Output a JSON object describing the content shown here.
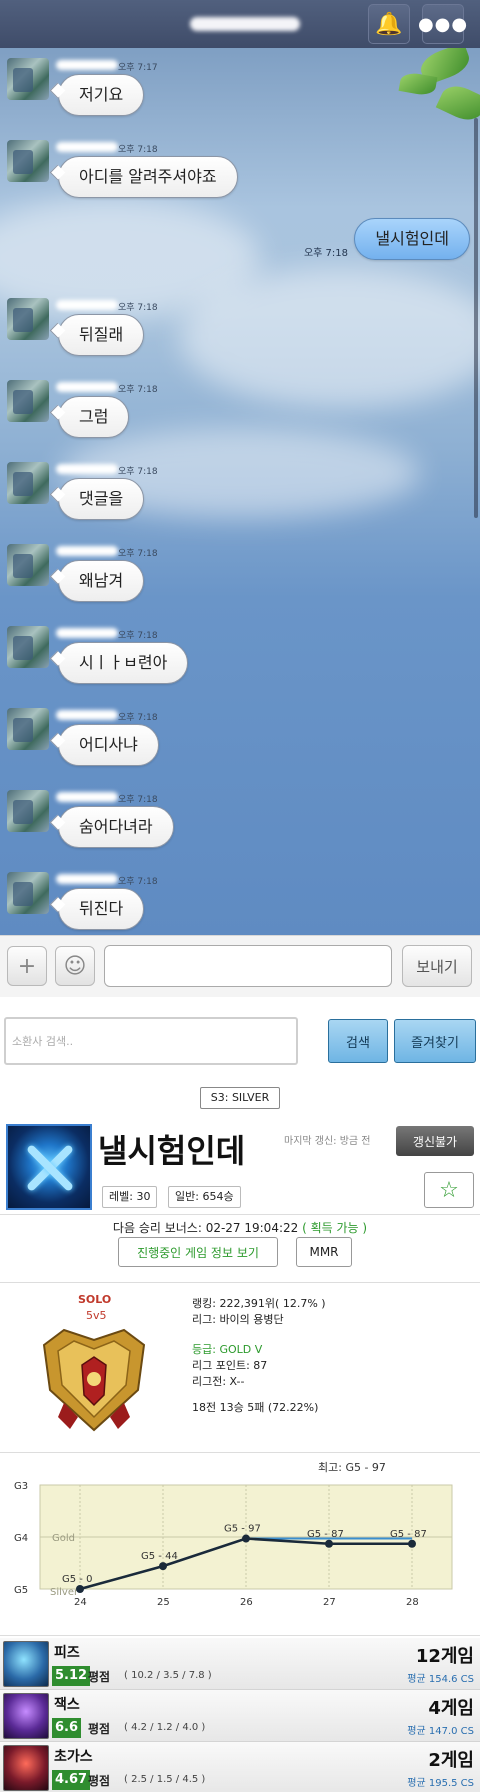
{
  "header": {
    "bell_icon": "bell-icon",
    "more_icon": "more-icon"
  },
  "chat": {
    "messages": [
      {
        "dir": "in",
        "time": "오후 7:17",
        "text": "저기요"
      },
      {
        "dir": "in",
        "time": "오후 7:18",
        "text": "아디를 알려주셔야죠"
      },
      {
        "dir": "out",
        "time": "오후 7:18",
        "text": "낼시험인데"
      },
      {
        "dir": "in",
        "time": "오후 7:18",
        "text": "뒤질래"
      },
      {
        "dir": "in",
        "time": "오후 7:18",
        "text": "그럼"
      },
      {
        "dir": "in",
        "time": "오후 7:18",
        "text": "댓글을"
      },
      {
        "dir": "in",
        "time": "오후 7:18",
        "text": "왜남겨"
      },
      {
        "dir": "in",
        "time": "오후 7:18",
        "text": "시ㅣㅏㅂ련아"
      },
      {
        "dir": "in",
        "time": "오후 7:18",
        "text": "어디사냐"
      },
      {
        "dir": "in",
        "time": "오후 7:18",
        "text": "숨어다녀라"
      },
      {
        "dir": "in",
        "time": "오후 7:18",
        "text": "뒤진다"
      }
    ]
  },
  "input_bar": {
    "plus_icon": "+",
    "emoji_icon": "☺",
    "send_label": "보내기"
  },
  "search": {
    "placeholder": "소환사 검색..",
    "search_label": "검색",
    "favorites_label": "즐겨찾기",
    "season_badge": "S3: SILVER"
  },
  "profile": {
    "summoner_name": "낼시험인데",
    "last_update": "마지막 갱신: 방금 전",
    "refresh_label": "갱신불가",
    "level": "레벨: 30",
    "normal_wins": "일반: 654승",
    "star_icon": "☆"
  },
  "bonus": {
    "text": "다음 승리 보너스: 02-27 19:04:22",
    "status": "( 획득 가능 )",
    "live_game_label": "진행중인 게임 정보 보기",
    "mmr_label": "MMR"
  },
  "ranked": {
    "queue": "SOLO",
    "mode": "5v5",
    "ranking": "랭킹: 222,391위( 12.7% )",
    "league": "리그: 바이의 용병단",
    "tier": "등급: GOLD V",
    "league_points": "리그 포인트: 87",
    "series": "리그전: X--",
    "record": "18전 13승 5패 (72.22%)"
  },
  "chart_data": {
    "type": "line",
    "title": "최고: G5 - 97",
    "categories": [
      "24",
      "25",
      "26",
      "27",
      "28"
    ],
    "y_ticks": [
      "G3",
      "G4",
      "G5"
    ],
    "band_labels": [
      "Gold",
      "Silver"
    ],
    "series": [
      {
        "values": [
          0,
          44,
          97,
          87,
          87
        ],
        "labels": [
          "G5 - 0",
          "G5 - 44",
          "G5 - 97",
          "G5 - 87",
          "G5 - 87"
        ],
        "color": "#1a2a3a"
      },
      {
        "values": [
          0,
          44,
          97,
          97,
          97
        ],
        "color": "#3a8fd0"
      }
    ],
    "colors": {
      "band": "#f3f2d2",
      "grid": "#c9c9a8"
    }
  },
  "champions": [
    {
      "name": "피즈",
      "kda": "5.12",
      "kda_label": "평점",
      "detail": "( 10.2 / 3.5 / 7.8 )",
      "games": "12게임",
      "cs": "평균 154.6 CS",
      "icon": "fizz-icon"
    },
    {
      "name": "잭스",
      "kda": "6.6",
      "kda_label": "평점",
      "detail": "( 4.2 / 1.2 / 4.0 )",
      "games": "4게임",
      "cs": "평균 147.0 CS",
      "icon": "jax-icon"
    },
    {
      "name": "초가스",
      "kda": "4.67",
      "kda_label": "평점",
      "detail": "( 2.5 / 1.5 / 4.5 )",
      "games": "2게임",
      "cs": "평균 195.5 CS",
      "icon": "chogath-icon"
    }
  ]
}
